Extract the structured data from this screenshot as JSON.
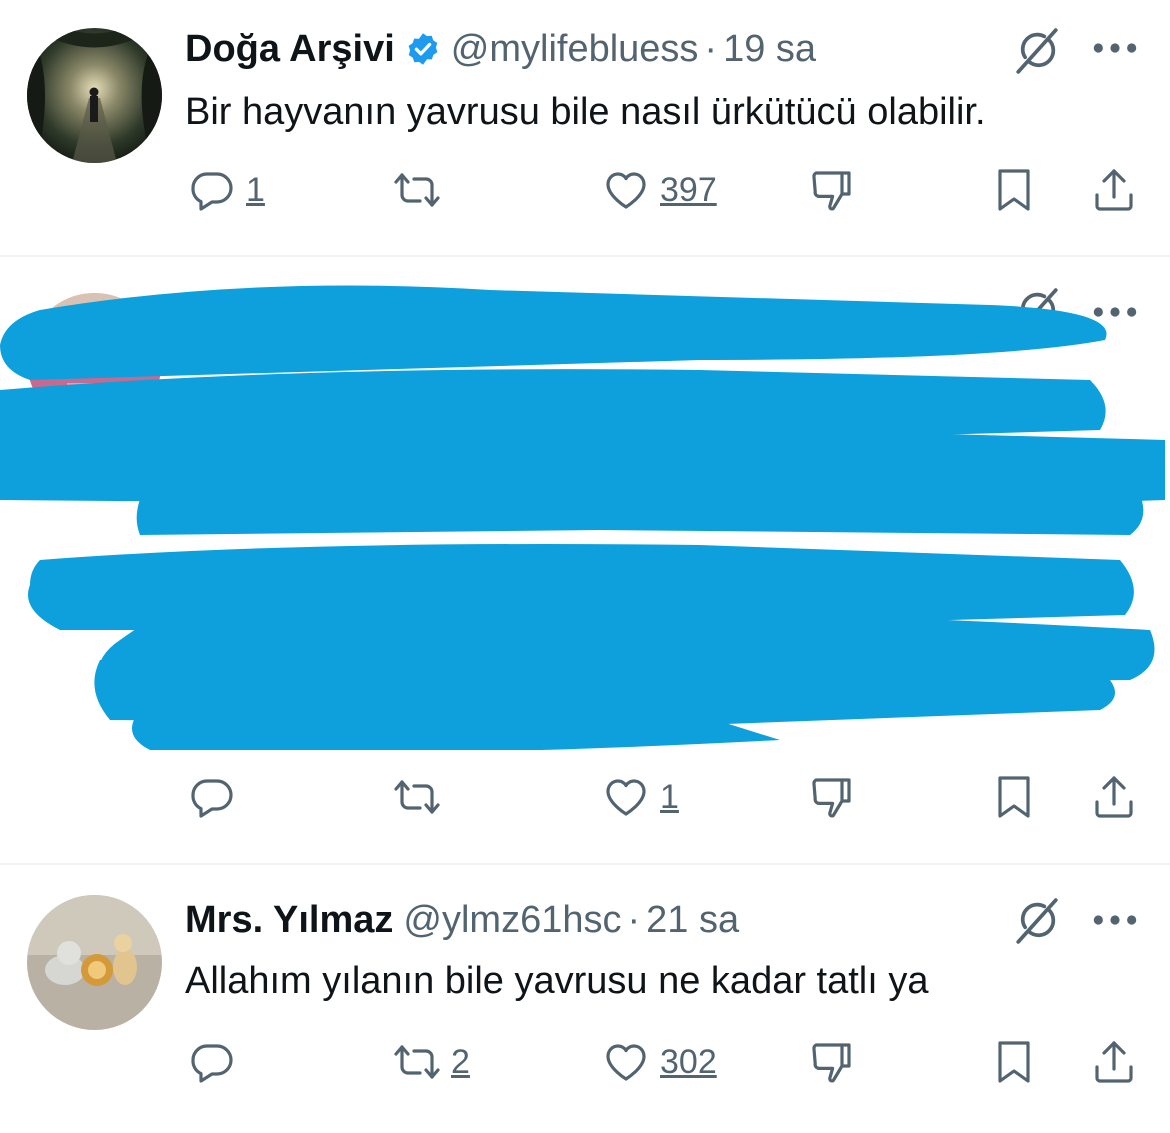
{
  "tweets": [
    {
      "name": "Doğa Arşivi",
      "verified": true,
      "handle": "@mylifebluess",
      "separator": "·",
      "time": "19 sa",
      "text": "Bir hayvanın yavrusu bile nasıl ürkütücü olabilir.",
      "reply_count": "1",
      "retweet_count": "",
      "like_count": "397"
    },
    {
      "name": "",
      "handle": "",
      "time": "",
      "text": "",
      "redacted": true,
      "reply_count": "",
      "retweet_count": "",
      "like_count": "1"
    },
    {
      "name": "Mrs. Yılmaz",
      "verified": false,
      "handle": "@ylmz61hsc",
      "separator": "·",
      "time": "21 sa",
      "text": "Allahım yılanın bile yavrusu ne kadar tatlı ya",
      "reply_count": "",
      "retweet_count": "2",
      "like_count": "302"
    }
  ],
  "icons": {
    "reply": "speech-bubble-icon",
    "retweet": "retweet-icon",
    "like": "heart-icon",
    "dislike": "thumbs-down-icon",
    "bookmark": "bookmark-icon",
    "share": "share-icon",
    "grok": "grok-icon",
    "more": "more-dots-icon",
    "verified": "verified-badge-icon"
  },
  "colors": {
    "text": "#0f1419",
    "secondary": "#536471",
    "verified": "#1d9bf0",
    "redaction": "#0ea0dc",
    "divider": "#eff3f4"
  }
}
